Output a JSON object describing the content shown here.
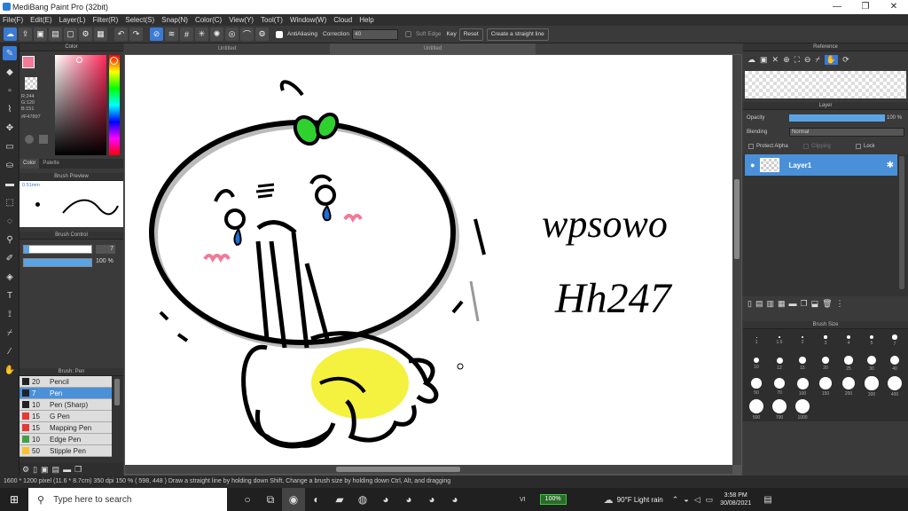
{
  "title": "MediBang Paint Pro (32bit)",
  "window_controls": [
    "—",
    "❐",
    "✕"
  ],
  "menu": [
    "File(F)",
    "Edit(E)",
    "Layer(L)",
    "Filter(R)",
    "Select(S)",
    "Snap(N)",
    "Color(C)",
    "View(Y)",
    "Tool(T)",
    "Window(W)",
    "Cloud",
    "Help"
  ],
  "toolbar": {
    "antialiasing": "AntiAliasing",
    "correction_label": "Correction",
    "correction_value": "40",
    "soft_edge": "Soft Edge",
    "key": "Key",
    "reset": "Reset",
    "straight_line": "Create a straight line"
  },
  "tabs": [
    "Untitled",
    "Untitled"
  ],
  "color_panel": {
    "title": "Color",
    "r": "R:244",
    "g": "G:120",
    "b": "B:151",
    "hex": "#F47897",
    "tab_color": "Color",
    "tab_palette": "Palette"
  },
  "brush_preview": {
    "title": "Brush Preview",
    "size": "0.51mm"
  },
  "brush_control": {
    "title": "Brush Control",
    "size_value": "7",
    "opacity_value": "100 %"
  },
  "brush_list": {
    "title": "Brush: Pen",
    "items": [
      {
        "size": "20",
        "name": "Pencil",
        "color": "#222222"
      },
      {
        "size": "7",
        "name": "Pen",
        "color": "#222222"
      },
      {
        "size": "10",
        "name": "Pen (Sharp)",
        "color": "#222222"
      },
      {
        "size": "15",
        "name": "G Pen",
        "color": "#e53935"
      },
      {
        "size": "15",
        "name": "Mapping Pen",
        "color": "#e53935"
      },
      {
        "size": "10",
        "name": "Edge Pen",
        "color": "#43a047"
      },
      {
        "size": "50",
        "name": "Stipple Pen",
        "color": "#fbc02d"
      }
    ]
  },
  "canvas_text": {
    "line1": "wpsowo",
    "line2": "Hh247"
  },
  "reference": {
    "title": "Reference"
  },
  "layer_panel": {
    "title": "Layer",
    "opacity_label": "Opacity",
    "opacity_value": "100 %",
    "blending_label": "Blending",
    "blending_value": "Normal",
    "protect_alpha": "Protect Alpha",
    "clipping": "Clipping",
    "lock": "Lock",
    "layer_name": "Layer1"
  },
  "brush_size": {
    "title": "Brush Size",
    "sizes": [
      "1",
      "1.5",
      "2",
      "3",
      "4",
      "5",
      "7",
      "10",
      "12",
      "15",
      "20",
      "25",
      "30",
      "40",
      "50",
      "70",
      "100",
      "150",
      "200",
      "300",
      "400",
      "500",
      "700",
      "1000"
    ]
  },
  "status": "1600 * 1200 pixel   (11.6 * 8.7cm)   350 dpi   150 %   ( 598, 448 )   Draw a straight line by holding down Shift, Change a brush size by holding down Ctrl, Alt, and dragging",
  "taskbar": {
    "search": "Type here to search",
    "lang": "VI",
    "battery": "100%",
    "weather": "90°F  Light rain",
    "time": "3:58 PM",
    "date": "30/08/2021"
  },
  "colors": {
    "accent": "#3a7bd5",
    "foreground": "#F47897",
    "highlight_yellow": "#f3f02a",
    "sprout_green": "#2fd12f"
  }
}
